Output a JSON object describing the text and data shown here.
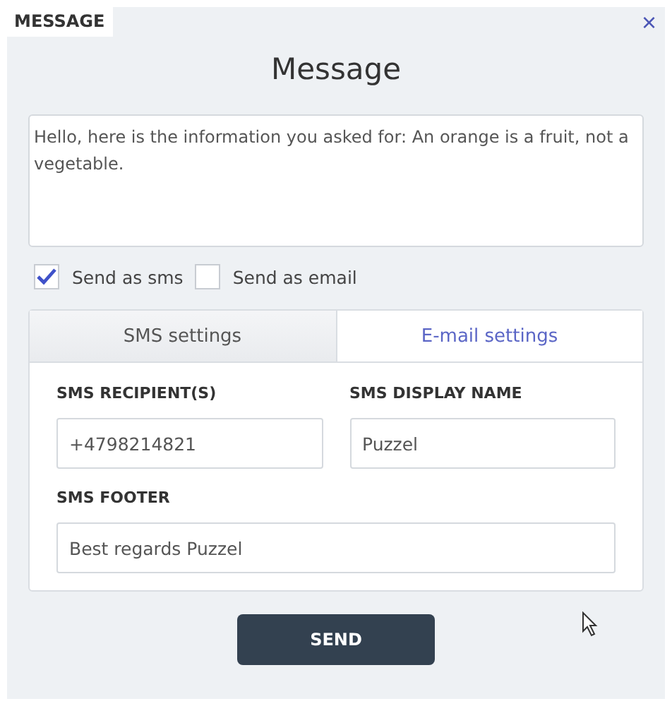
{
  "panel_tab": {
    "label": "MESSAGE"
  },
  "close": {
    "label": "×"
  },
  "title": "Message",
  "message": {
    "value": "Hello, here is the information you asked for: An orange is a fruit, not a vegetable."
  },
  "send_options": [
    {
      "label": "Send as sms",
      "checked": true
    },
    {
      "label": "Send as email",
      "checked": false
    }
  ],
  "settings_tabs": [
    {
      "label": "SMS settings",
      "selected": true
    },
    {
      "label": "E-mail settings",
      "selected": false
    }
  ],
  "fields": [
    {
      "label": "SMS RECIPIENT(S)",
      "value": "+4798214821",
      "wide": false
    },
    {
      "label": "SMS DISPLAY NAME",
      "value": "Puzzel",
      "wide": false
    },
    {
      "label": "SMS FOOTER",
      "value": "Best regards Puzzel",
      "wide": true
    }
  ],
  "send_button": {
    "label": "SEND"
  }
}
